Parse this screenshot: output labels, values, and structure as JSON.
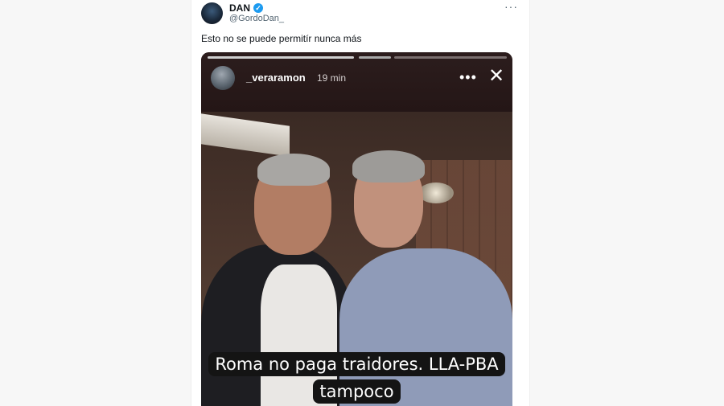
{
  "tweet": {
    "author_name": "DAN",
    "author_handle": "@GordoDan_",
    "text": "Esto no se puede permitír nunca más",
    "more_icon": "more-horizontal-icon",
    "verified_icon": "verified-badge-icon"
  },
  "story": {
    "username": "_veraramon",
    "time_ago": "19 min",
    "caption_line1": "Roma no paga traidores. LLA-PBA",
    "caption_line2": "tampoco",
    "more_icon": "more-horizontal-icon",
    "close_icon": "close-icon"
  },
  "colors": {
    "verified": "#1d9bf0",
    "caption_bg": "#141414"
  }
}
